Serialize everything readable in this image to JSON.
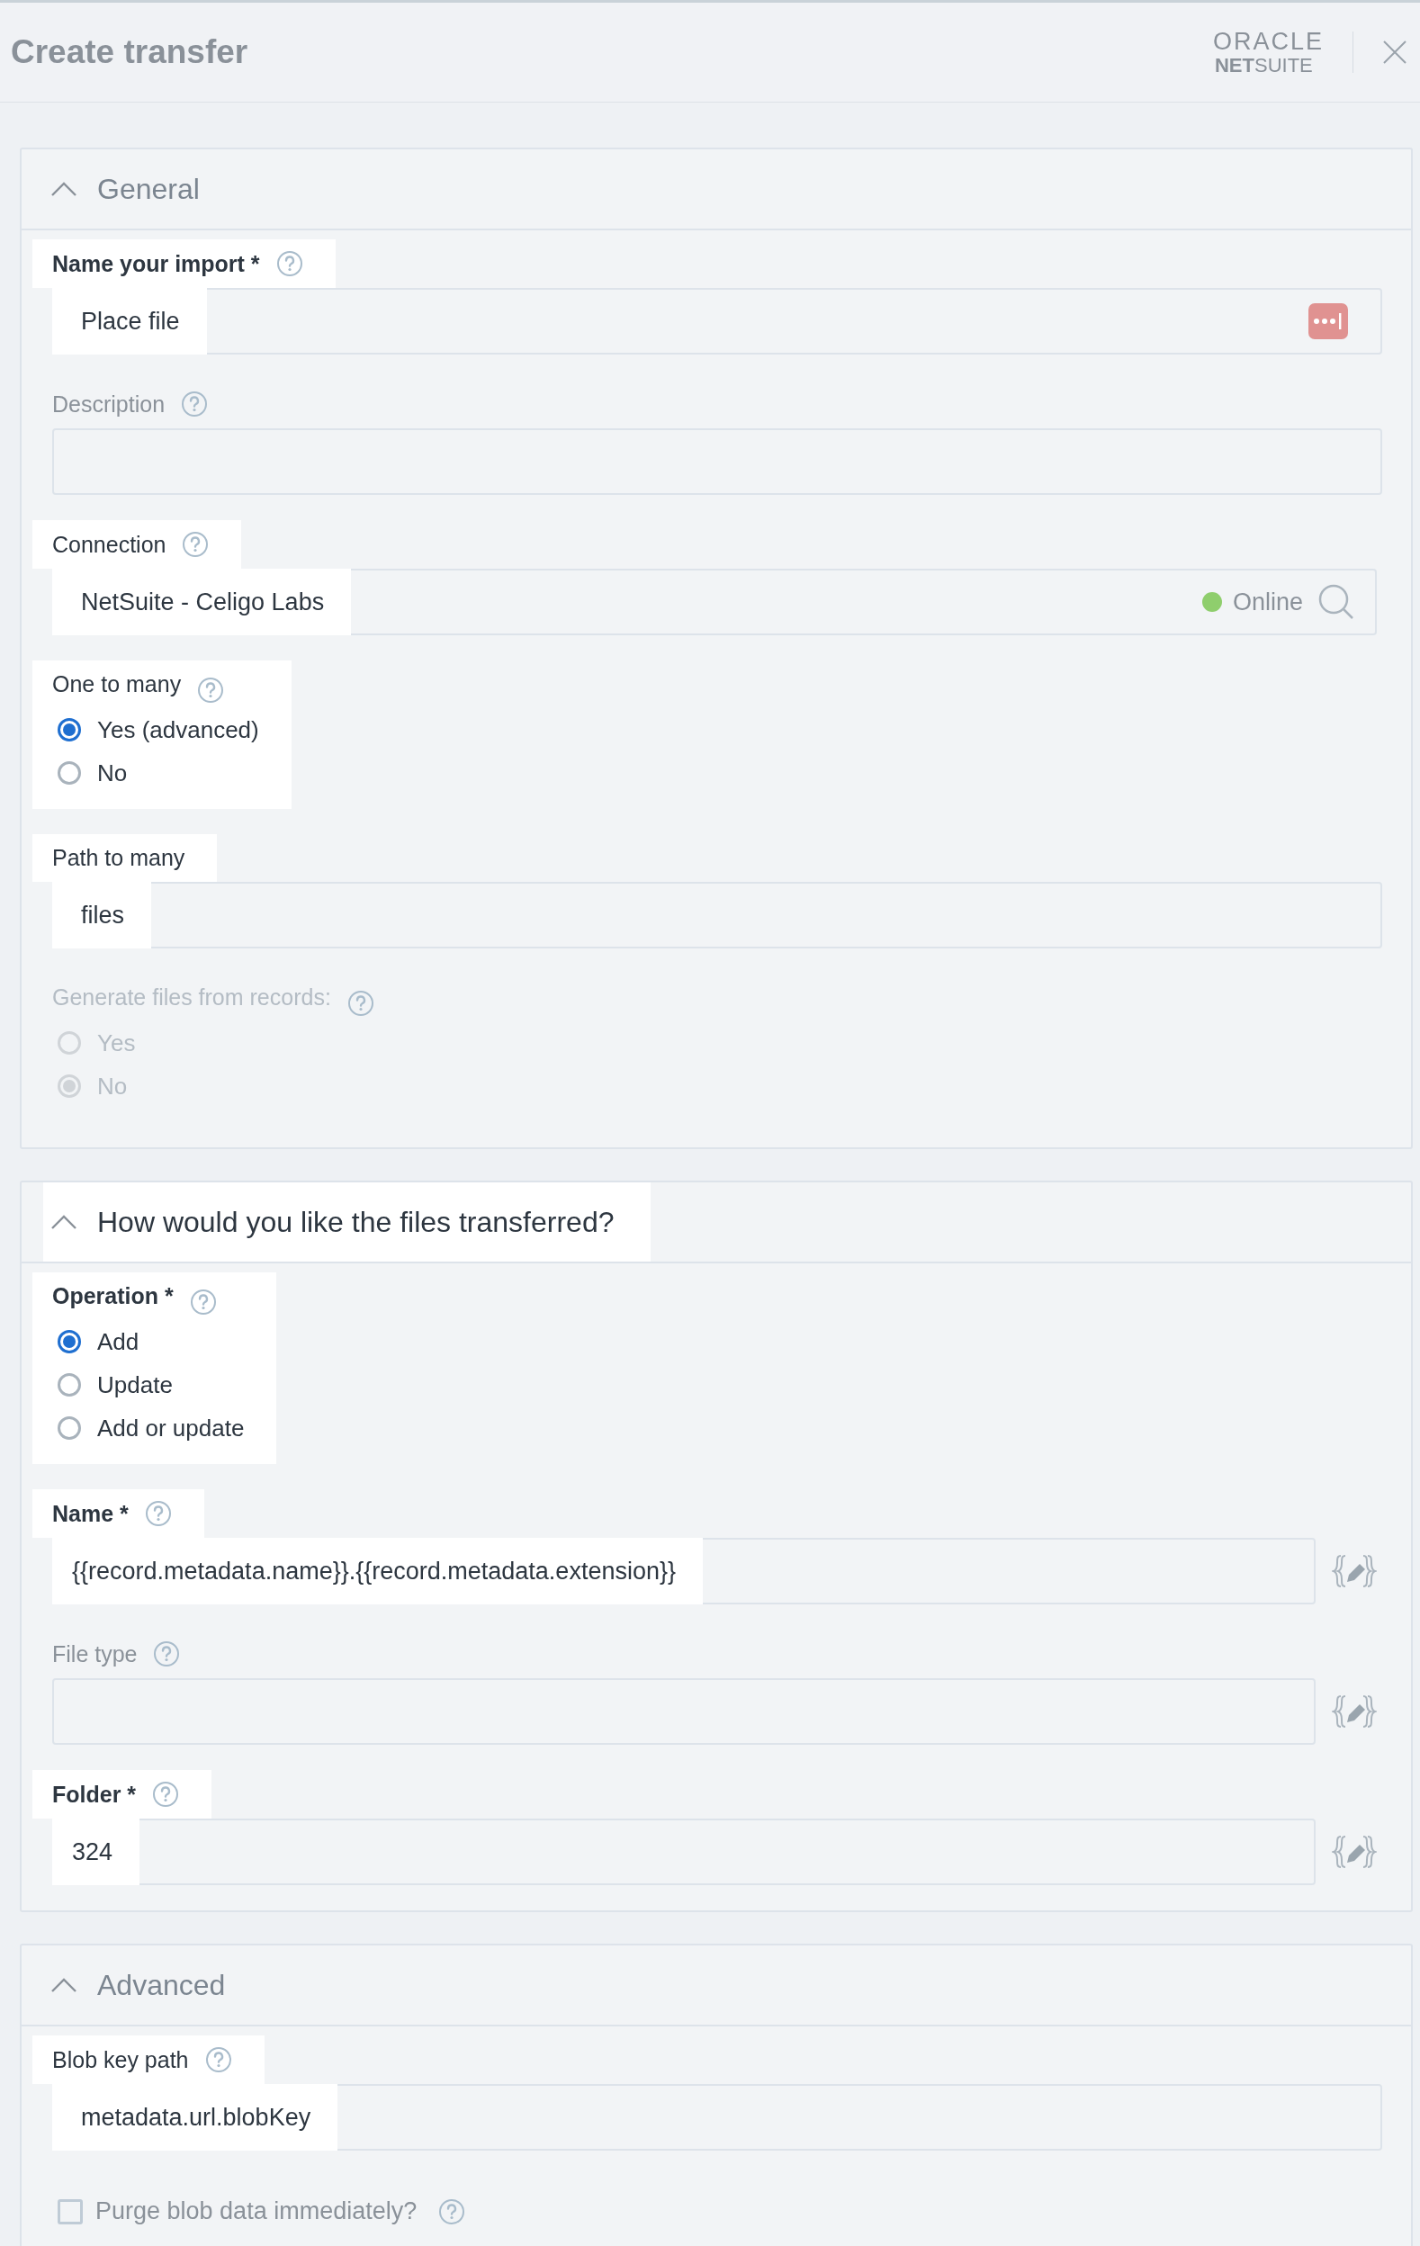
{
  "header": {
    "title": "Create transfer",
    "logo_top": "ORACLE",
    "logo_bottom": "**NET**SUITE"
  },
  "sections": [
    {
      "title": "General",
      "expanded": true,
      "highlighted": false,
      "fields": [
        {
          "kind": "text",
          "label": "Name your import *",
          "bold": true,
          "help": true,
          "value": "Place file",
          "highlighted": true,
          "adornment": {
            "kind": "mask"
          }
        },
        {
          "kind": "text",
          "label": "Description",
          "bold": false,
          "help": true,
          "highlighted": false
        },
        {
          "kind": "text",
          "label": "Connection",
          "bold": false,
          "help": true,
          "value": "NetSuite - Celigo Labs",
          "highlighted": true,
          "status": {
            "label": "Online",
            "color": "#8fce6d"
          },
          "adornment": {
            "kind": "search"
          }
        },
        {
          "kind": "radio",
          "label": "One to many",
          "bold": false,
          "help": true,
          "highlighted": true,
          "disabled": false,
          "options": [
            {
              "label": "Yes (advanced)",
              "selected": true
            },
            {
              "label": "No",
              "selected": false
            }
          ]
        },
        {
          "kind": "text",
          "label": "Path to many",
          "bold": false,
          "help": false,
          "value": "files",
          "highlighted": true
        },
        {
          "kind": "radio",
          "label": "Generate files from records:",
          "bold": false,
          "help": true,
          "highlighted": false,
          "disabled": true,
          "options": [
            {
              "label": "Yes",
              "selected": false
            },
            {
              "label": "No",
              "selected": true
            }
          ]
        }
      ]
    },
    {
      "title": "How would you like the files transferred?",
      "expanded": true,
      "highlighted": true,
      "fields": [
        {
          "kind": "radio",
          "label": "Operation *",
          "bold": true,
          "help": true,
          "highlighted": true,
          "disabled": false,
          "options": [
            {
              "label": "Add",
              "selected": true
            },
            {
              "label": "Update",
              "selected": false
            },
            {
              "label": "Add or update",
              "selected": false
            }
          ]
        },
        {
          "kind": "text",
          "label": "Name *",
          "bold": true,
          "help": true,
          "value": "{{record.metadata.name}}.{{record.metadata.extension}}",
          "highlighted": true,
          "adornment": {
            "kind": "expression"
          }
        },
        {
          "kind": "text",
          "label": "File type",
          "bold": false,
          "help": true,
          "highlighted": false,
          "adornment": {
            "kind": "expression"
          }
        },
        {
          "kind": "text",
          "label": "Folder *",
          "bold": true,
          "help": true,
          "value": "324",
          "highlighted": true,
          "adornment": {
            "kind": "expression"
          }
        }
      ]
    },
    {
      "title": "Advanced",
      "expanded": true,
      "highlighted": false,
      "fields": [
        {
          "kind": "text",
          "label": "Blob key path",
          "bold": false,
          "help": true,
          "value": "metadata.url.blobKey",
          "highlighted": true
        },
        {
          "kind": "checkbox",
          "label": "Purge blob data immediately?",
          "help": true,
          "checked": false
        }
      ]
    }
  ]
}
